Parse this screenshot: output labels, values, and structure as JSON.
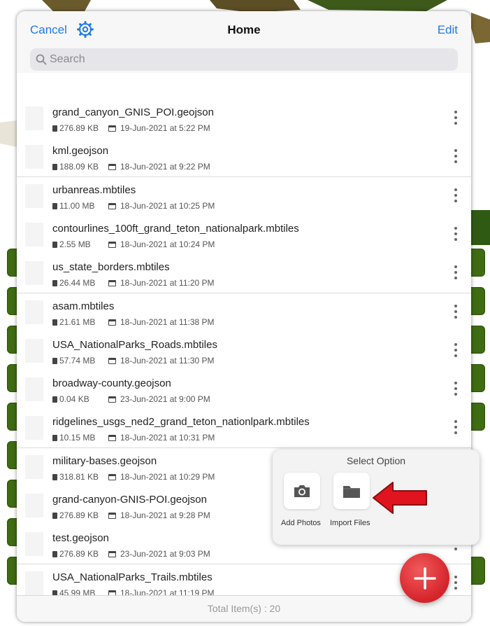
{
  "nav": {
    "cancel": "Cancel",
    "title": "Home",
    "edit": "Edit"
  },
  "search": {
    "placeholder": "Search"
  },
  "files": [
    {
      "name": "grand_canyon_GNIS_POI.geojson",
      "size": "276.89 KB",
      "date": "19-Jun-2021 at 5:22 PM"
    },
    {
      "name": "kml.geojson",
      "size": "188.09 KB",
      "date": "18-Jun-2021 at 9:22 PM"
    },
    {
      "name": "urbanreas.mbtiles",
      "size": "11.00 MB",
      "date": "18-Jun-2021 at 10:25 PM"
    },
    {
      "name": "contourlines_100ft_grand_teton_nationalpark.mbtiles",
      "size": "2.55 MB",
      "date": "18-Jun-2021 at 10:24 PM"
    },
    {
      "name": "us_state_borders.mbtiles",
      "size": "26.44 MB",
      "date": "18-Jun-2021 at 11:20 PM"
    },
    {
      "name": "asam.mbtiles",
      "size": "21.61 MB",
      "date": "18-Jun-2021 at 11:38 PM"
    },
    {
      "name": "USA_NationalParks_Roads.mbtiles",
      "size": "57.74 MB",
      "date": "18-Jun-2021 at 11:30 PM"
    },
    {
      "name": "broadway-county.geojson",
      "size": "0.04 KB",
      "date": "23-Jun-2021 at 9:00 PM"
    },
    {
      "name": "ridgelines_usgs_ned2_grand_teton_nationlpark.mbtiles",
      "size": "10.15 MB",
      "date": "18-Jun-2021 at 10:31 PM"
    },
    {
      "name": "military-bases.geojson",
      "size": "318.81 KB",
      "date": "18-Jun-2021 at 10:29 PM"
    },
    {
      "name": "grand-canyon-GNIS-POI.geojson",
      "size": "276.89 KB",
      "date": "18-Jun-2021 at 9:28 PM"
    },
    {
      "name": "test.geojson",
      "size": "276.89 KB",
      "date": "23-Jun-2021 at 9:03 PM"
    },
    {
      "name": "USA_NationalParks_Trails.mbtiles",
      "size": "45.99 MB",
      "date": "18-Jun-2021 at 11:19 PM"
    }
  ],
  "footer": {
    "total": "Total Item(s) : 20"
  },
  "popover": {
    "title": "Select Option",
    "add_photos": "Add Photos",
    "import_files": "Import Files"
  },
  "colors": {
    "accent": "#1f7ce0",
    "fab": "#d4232b",
    "arrow": "#e0141e",
    "map_green": "#3e6c12"
  }
}
